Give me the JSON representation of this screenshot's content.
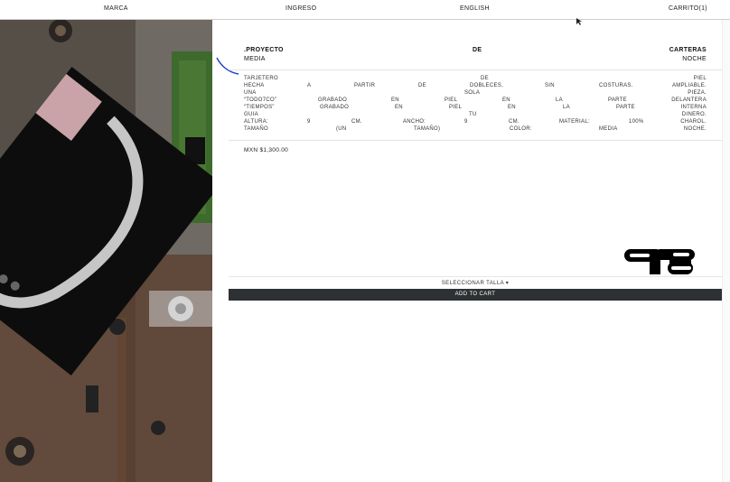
{
  "nav": {
    "marca": "MARCA",
    "ingreso": "INGRESO",
    "english": "ENGLISH",
    "carrito": "CARRITO(1)"
  },
  "product": {
    "title_words": [
      ".PROYECTO",
      "DE",
      "CARTERAS"
    ],
    "subtitle_left": "MEDIA",
    "subtitle_right": "NOCHE",
    "description_lines": [
      [
        "TARJETERO",
        "DE",
        "PIEL"
      ],
      [
        "HECHA",
        "A",
        "PARTIR",
        "DE",
        "DOBLECES,",
        "SIN",
        "COSTURAS.",
        "AMPLIABLE."
      ],
      [
        "UNA",
        "SOLA",
        "PIEZA."
      ],
      [
        "“TODO7CO”",
        "GRABADO",
        "EN",
        "PIEL",
        "EN",
        "LA",
        "PARTE",
        "DELANTERA"
      ],
      [
        "“TIEMPOS”",
        "GRABADO",
        "EN",
        "PIEL",
        "EN",
        "LA",
        "PARTE",
        "INTERNA"
      ],
      [
        "GUIA",
        "TU",
        "DINERO."
      ],
      [
        "ALTURA:",
        "9",
        "CM.",
        "ANCHO:",
        "9",
        "CM.",
        "MATERIAL:",
        "100%",
        "CHAROL."
      ],
      [
        "TAMAÑO",
        "(UN",
        "TAMAÑO)",
        "COLOR:",
        "MEDIA",
        "NOCHE."
      ]
    ],
    "price": "MXN $1,300.00",
    "size_selector": "SELECCIONAR TALLA ▾",
    "add_to_cart": "ADD TO CART"
  },
  "colors": {
    "cart_button": "#2e3133",
    "pen_mark": "#1f3fd1",
    "circuit_green": "#3f6a2e"
  },
  "icons": {
    "brand_logo": "todo7co-logo",
    "mouse_cursor": "cursor-icon"
  }
}
